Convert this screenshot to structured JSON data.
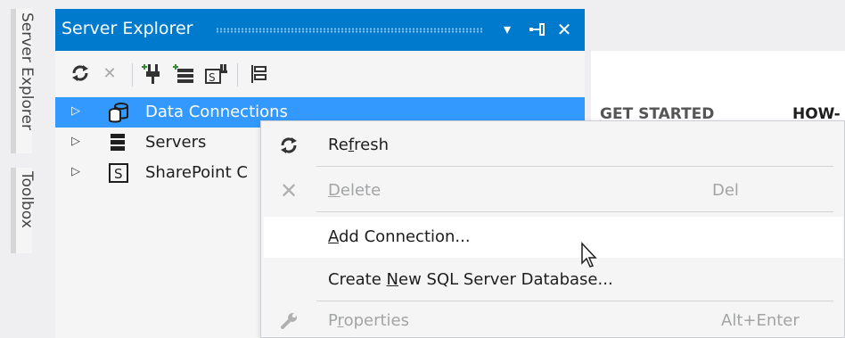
{
  "sidebar_tabs": [
    "Server Explorer",
    "Toolbox"
  ],
  "panel": {
    "title": "Server Explorer",
    "controls": {
      "dropdown": "▾",
      "pin": "⊣",
      "close": "✕"
    },
    "toolbar": [
      {
        "name": "refresh-icon"
      },
      {
        "name": "stop-icon"
      },
      {
        "name": "connect-to-database-icon"
      },
      {
        "name": "connect-to-server-icon"
      },
      {
        "name": "connect-to-sharepoint-icon"
      },
      {
        "name": "properties-icon"
      }
    ],
    "tree": [
      {
        "label": "Data Connections",
        "selected": true,
        "icon": "database-icon"
      },
      {
        "label": "Servers",
        "selected": false,
        "icon": "server-icon"
      },
      {
        "label": "SharePoint Connections",
        "visible_label": "SharePoint C",
        "selected": false,
        "icon": "sharepoint-icon"
      }
    ]
  },
  "document": {
    "tabs": [
      "GET STARTED",
      "HOW-"
    ]
  },
  "context_menu": {
    "items": [
      {
        "pre": "Re",
        "ul": "f",
        "post": "resh",
        "shortcut": "",
        "enabled": true,
        "icon": "refresh-icon"
      },
      {
        "pre": "",
        "ul": "D",
        "post": "elete",
        "shortcut": "Del",
        "enabled": false,
        "icon": "delete-icon"
      },
      {
        "pre": "",
        "ul": "A",
        "post": "dd Connection...",
        "shortcut": "",
        "enabled": true,
        "hover": true,
        "icon": ""
      },
      {
        "pre": "Create ",
        "ul": "N",
        "post": "ew SQL Server Database...",
        "shortcut": "",
        "enabled": true,
        "icon": ""
      },
      {
        "pre": "P",
        "ul": "r",
        "post": "operties",
        "shortcut": "Alt+Enter",
        "enabled": false,
        "icon": "wrench-icon"
      }
    ]
  }
}
